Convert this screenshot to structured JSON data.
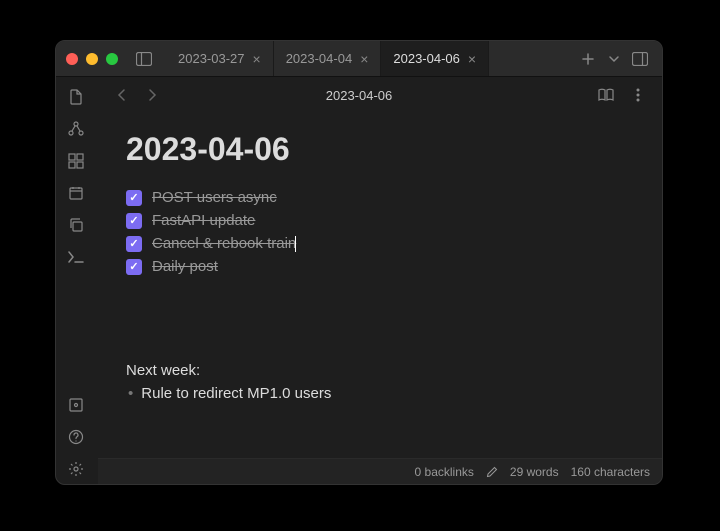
{
  "tabs": [
    {
      "label": "2023-03-27"
    },
    {
      "label": "2023-04-04"
    },
    {
      "label": "2023-04-06"
    }
  ],
  "doc": {
    "title": "2023-04-06",
    "heading": "2023-04-06",
    "tasks": [
      {
        "text": "POST users async"
      },
      {
        "text": "FastAPI update"
      },
      {
        "text": "Cancel & rebook train"
      },
      {
        "text": "Daily post"
      }
    ],
    "nextweek_label": "Next week:",
    "nextweek_items": [
      "Rule to redirect MP1.0 users"
    ]
  },
  "status": {
    "backlinks": "0 backlinks",
    "words": "29 words",
    "chars": "160 characters"
  }
}
